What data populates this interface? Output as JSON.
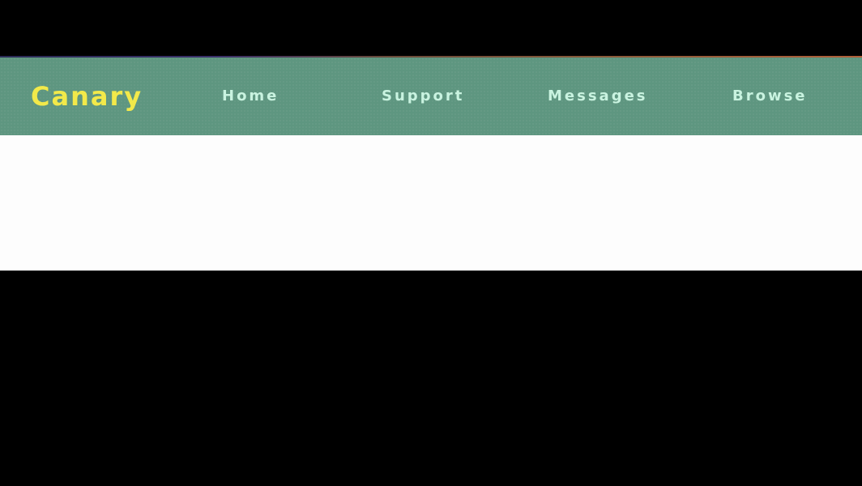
{
  "brand": {
    "name": "Canary"
  },
  "nav": {
    "items": [
      {
        "label": "Home"
      },
      {
        "label": "Support"
      },
      {
        "label": "Messages"
      },
      {
        "label": "Browse"
      }
    ]
  },
  "colors": {
    "navbar_bg": "#5e9680",
    "brand_text": "#f2e94a",
    "nav_text": "#c9f3e0",
    "content_bg": "#fdfdfd",
    "letterbox": "#000000"
  }
}
